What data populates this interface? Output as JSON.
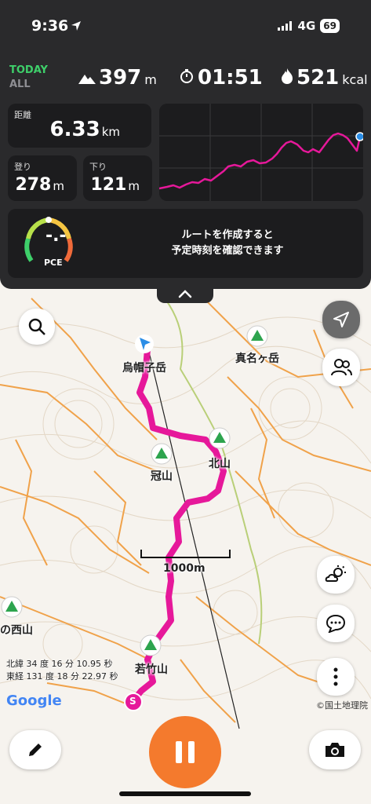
{
  "status_bar": {
    "time": "9:36",
    "network": "4G",
    "battery": "69"
  },
  "stats": {
    "today_label": "TODAY",
    "all_label": "ALL",
    "elevation_value": "397",
    "elevation_unit": "m",
    "time_value": "01:51",
    "calories_value": "521",
    "calories_unit": "kcal"
  },
  "distance": {
    "label": "距離",
    "value": "6.33",
    "unit": "km"
  },
  "ascent": {
    "label": "登り",
    "value": "278",
    "unit": "m"
  },
  "descent": {
    "label": "下り",
    "value": "121",
    "unit": "m"
  },
  "pace": {
    "value": "-.-",
    "label": "PCE",
    "message_line1": "ルートを作成すると",
    "message_line2": "予定時刻を確認できます"
  },
  "map": {
    "labels": {
      "eboshi": "烏帽子岳",
      "mana": "真名ヶ岳",
      "kanmuri": "冠山",
      "kita": "北山",
      "nishi": "の西山",
      "wakatake": "若竹山"
    },
    "scale_label": "1000m",
    "coords_lat": "北緯 34 度 16 分 10.95 秒",
    "coords_lon": "東経 131 度 18 分 22.97 秒",
    "google": "Google",
    "copyright": "©国土地理院",
    "start_marker": "S"
  },
  "colors": {
    "accent": "#f47a2d",
    "track": "#e6189a",
    "today": "#3ecf6a"
  },
  "icons": [
    "navigation-icon",
    "search-icon",
    "location-arrow-icon",
    "people-icon",
    "weather-icon",
    "chat-icon",
    "more-icon",
    "pencil-icon",
    "camera-icon",
    "pause-icon",
    "chevron-up-icon",
    "mountain-icon"
  ]
}
